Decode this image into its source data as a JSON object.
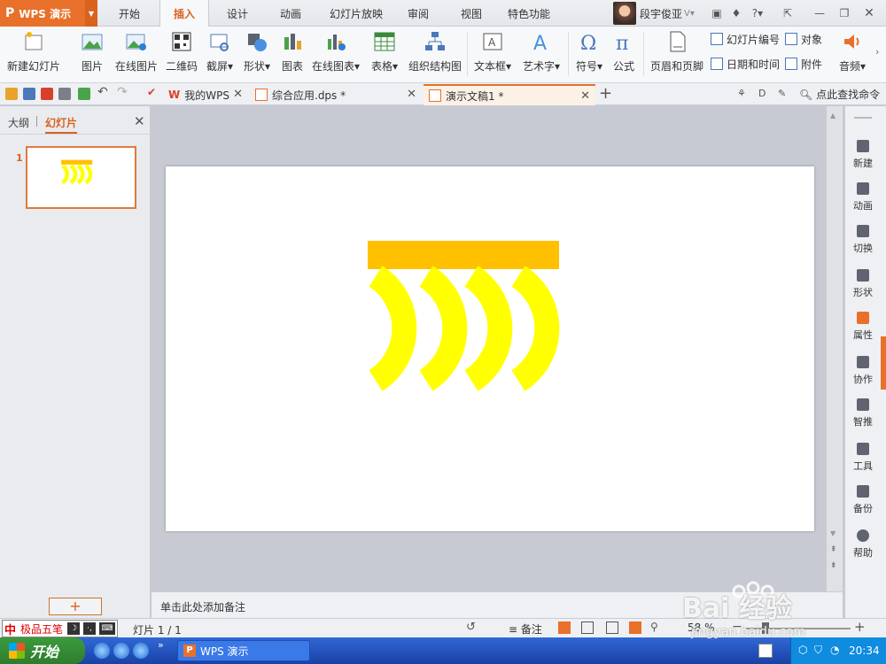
{
  "app": {
    "logo_text": "WPS 演示",
    "logo_mark": "P"
  },
  "menu_tabs": [
    {
      "label": "开始"
    },
    {
      "label": "插入"
    },
    {
      "label": "设计"
    },
    {
      "label": "动画"
    },
    {
      "label": "幻灯片放映"
    },
    {
      "label": "审阅"
    },
    {
      "label": "视图"
    },
    {
      "label": "特色功能"
    }
  ],
  "user": {
    "name": "段宇俊亚"
  },
  "ribbon": {
    "new_slide": "新建幻灯片",
    "picture": "图片",
    "online_picture": "在线图片",
    "qr_code": "二维码",
    "screenshot": "截屏",
    "shapes": "形状",
    "chart": "图表",
    "online_chart": "在线图表",
    "table": "表格",
    "org_chart": "组织结构图",
    "textbox": "文本框",
    "wordart": "艺术字",
    "symbol": "符号",
    "formula": "公式",
    "header_footer": "页眉和页脚",
    "slide_number": "幻灯片编号",
    "object": "对象",
    "date_time": "日期和时间",
    "attachment": "附件",
    "audio": "音频"
  },
  "doc_tabs": [
    {
      "label": "我的WPS"
    },
    {
      "label": "综合应用.dps *"
    },
    {
      "label": "演示文稿1 *"
    }
  ],
  "find_command": "点此查找命令",
  "left_panel": {
    "outline_tab": "大纲",
    "slides_tab": "幻灯片",
    "slide_number": "1",
    "add_slide": "+"
  },
  "notes_placeholder": "单击此处添加备注",
  "right_sidebar": [
    {
      "label": "新建"
    },
    {
      "label": "动画"
    },
    {
      "label": "切换"
    },
    {
      "label": "形状"
    },
    {
      "label": "属性"
    },
    {
      "label": "协作"
    },
    {
      "label": "智推"
    },
    {
      "label": "工具"
    },
    {
      "label": "备份"
    },
    {
      "label": "帮助"
    }
  ],
  "status": {
    "slide_info": "灯片 1 / 1",
    "notes": "备注",
    "zoom": "58 %"
  },
  "ime": {
    "mark": "中",
    "name": "极品五笔"
  },
  "taskbar": {
    "start": "开始",
    "task_label": "WPS 演示",
    "clock": "20:34"
  },
  "watermark": {
    "brand": "Bai 经验",
    "url": "jingyan.baidu.com"
  },
  "colors": {
    "accent": "#e8702a",
    "shape_bar": "#ffc000",
    "shape_arc": "#ffff00"
  }
}
